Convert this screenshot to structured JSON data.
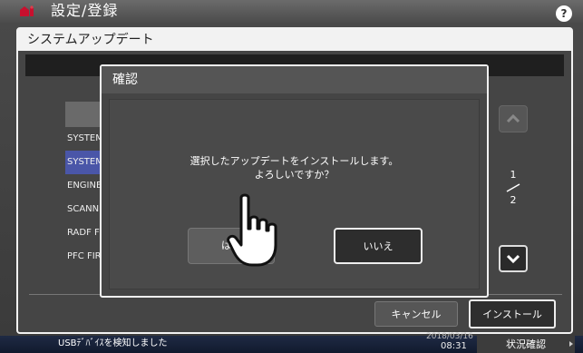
{
  "topbar": {
    "title": "設定/登録",
    "help_label": "?",
    "icon": "settings-house-icon"
  },
  "panel": {
    "title": "システムアップデート",
    "list_items": [
      {
        "label": "SYSTEM",
        "selected": false
      },
      {
        "label": "SYSTEM",
        "selected": true
      },
      {
        "label": "ENGINE",
        "selected": false
      },
      {
        "label": "SCANNER",
        "selected": false
      },
      {
        "label": "RADF FIRMWARE",
        "selected": false
      },
      {
        "label": "PFC FIRMWARE",
        "selected": false
      }
    ],
    "page": {
      "current": "1",
      "total": "2"
    },
    "cancel_label": "キャンセル",
    "install_label": "インストール"
  },
  "dialog": {
    "title": "確認",
    "message_line1": "選択したアップデートをインストールします。",
    "message_line2": "よろしいですか？",
    "yes_label": "はい",
    "no_label": "いいえ"
  },
  "statusbar": {
    "message": "USBﾃﾞﾊﾞｲｽを検知しました",
    "date": "2018/03/16",
    "time": "08:31",
    "status_button": "状況確認"
  },
  "colors": {
    "selected_row": "#4a56a8",
    "background": "#454545",
    "statusbar": "#111a2e"
  }
}
